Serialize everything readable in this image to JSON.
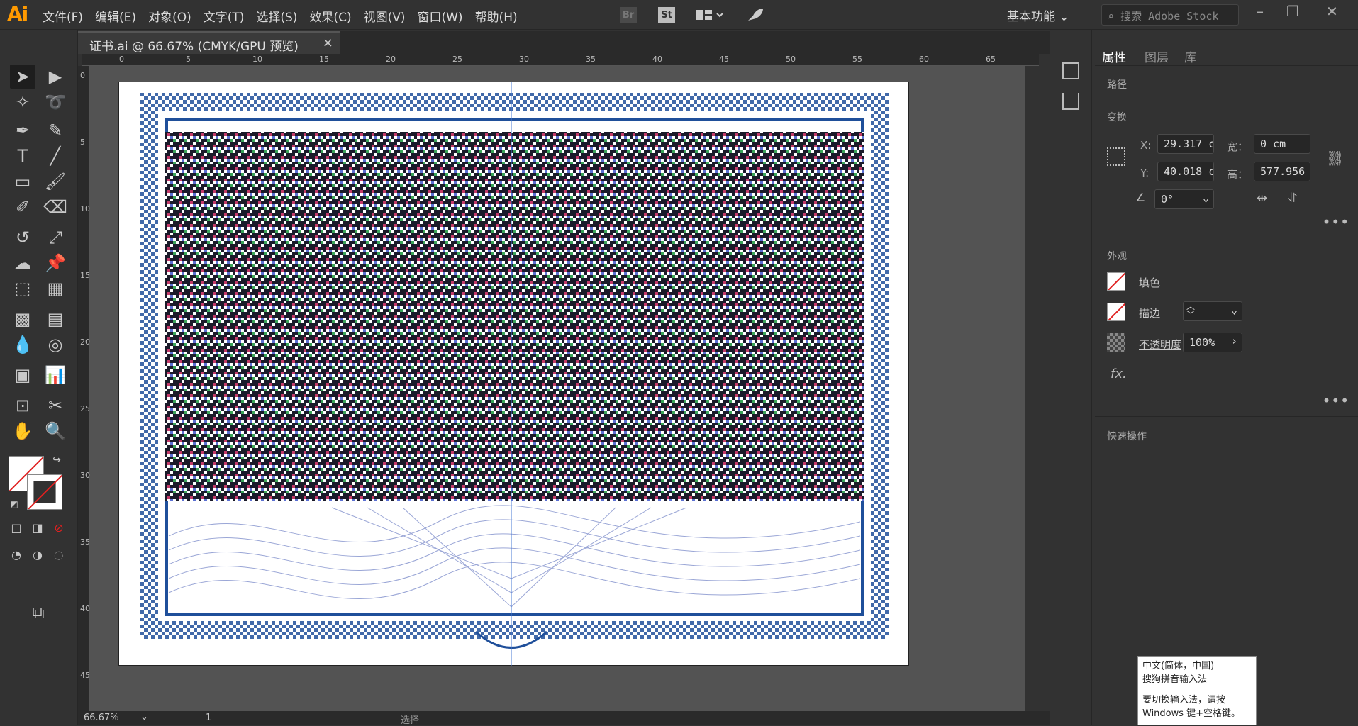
{
  "app": {
    "logo": "Ai",
    "workspace": "基本功能",
    "search_placeholder": "搜索 Adobe Stock",
    "bridge": "Br",
    "stock": "St"
  },
  "menu": [
    "文件(F)",
    "编辑(E)",
    "对象(O)",
    "文字(T)",
    "选择(S)",
    "效果(C)",
    "视图(V)",
    "窗口(W)",
    "帮助(H)"
  ],
  "document": {
    "tab_title": "证书.ai @ 66.67% (CMYK/GPU 预览)",
    "close": "×"
  },
  "ruler_h": [
    "0",
    "5",
    "10",
    "15",
    "20",
    "25",
    "30",
    "35",
    "40",
    "45",
    "50",
    "55",
    "60",
    "65"
  ],
  "ruler_v": [
    "0",
    "5",
    "10",
    "15",
    "20",
    "25",
    "30",
    "35",
    "40",
    "45"
  ],
  "status": {
    "zoom": "66.67%",
    "artboard": "1",
    "tool": "选择"
  },
  "properties": {
    "tabs": [
      "属性",
      "图层",
      "库"
    ],
    "object_type": "路径",
    "transform": {
      "title": "变换",
      "x_label": "X:",
      "x": "29.317 c",
      "y_label": "Y:",
      "y": "40.018 c",
      "w_label": "宽：",
      "w": "0 cm",
      "h_label": "高：",
      "h": "577.956",
      "angle": "0°"
    },
    "appearance": {
      "title": "外观",
      "fill": "填色",
      "stroke": "描边",
      "opacity_label": "不透明度",
      "opacity": "100%",
      "fx": "fx."
    },
    "quick_actions": "快速操作"
  },
  "ime": {
    "line1": "中文(简体，中国)",
    "line2": "搜狗拼音输入法",
    "line3": "要切换输入法，请按",
    "line4": "Windows 键+空格键。"
  },
  "colors": {
    "accent": "#ff9a00",
    "frame": "#1f4f9a",
    "guilloche": "#9aa6d6"
  }
}
